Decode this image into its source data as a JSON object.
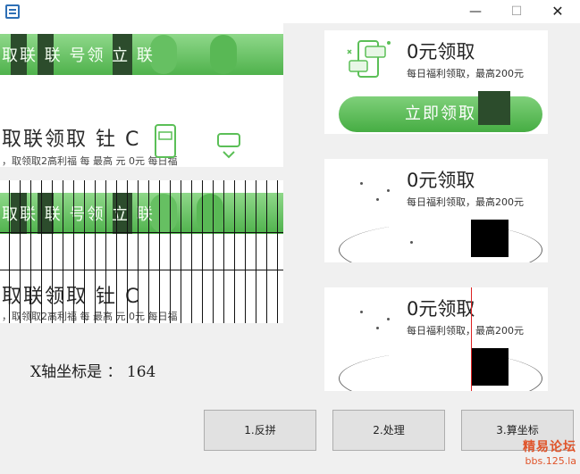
{
  "window": {
    "min_glyph": "—",
    "max_glyph": "☐",
    "close_glyph": "✕",
    "icon": "app-icon"
  },
  "puzzle_strips": {
    "row1_text": "取联 联 号领 立 联",
    "row2_text": "取联领取   钍 C",
    "row2_small": "，取领取2高利福 每    最高   元 0元  每日福",
    "row1b_text": "取联 联 号领 立 联",
    "row2b_text": "取联领取   钍 C",
    "row2b_small": "，取领取2高利福 每    最高   元 0元  每日福"
  },
  "coord": {
    "label": "X轴坐标是 ： 164"
  },
  "cards": [
    {
      "title": "0元领取",
      "subtitle": "每日福利领取，最高200元",
      "button": "立即领取",
      "icon": "phone-chat-icon"
    },
    {
      "title": "0元领取",
      "subtitle": "每日福利领取，最高200元"
    },
    {
      "title": "0元领取",
      "subtitle": "每日福利领取，最高200元"
    }
  ],
  "buttons": {
    "reassemble": "1.反拼",
    "process": "2.处理",
    "compute": "3.算坐标"
  },
  "watermark": {
    "main": "精易论坛",
    "sub": "bbs.125.la"
  },
  "colors": {
    "green": "#4fb24c",
    "marker_red": "#d22222",
    "watermark": "#e0542a"
  }
}
